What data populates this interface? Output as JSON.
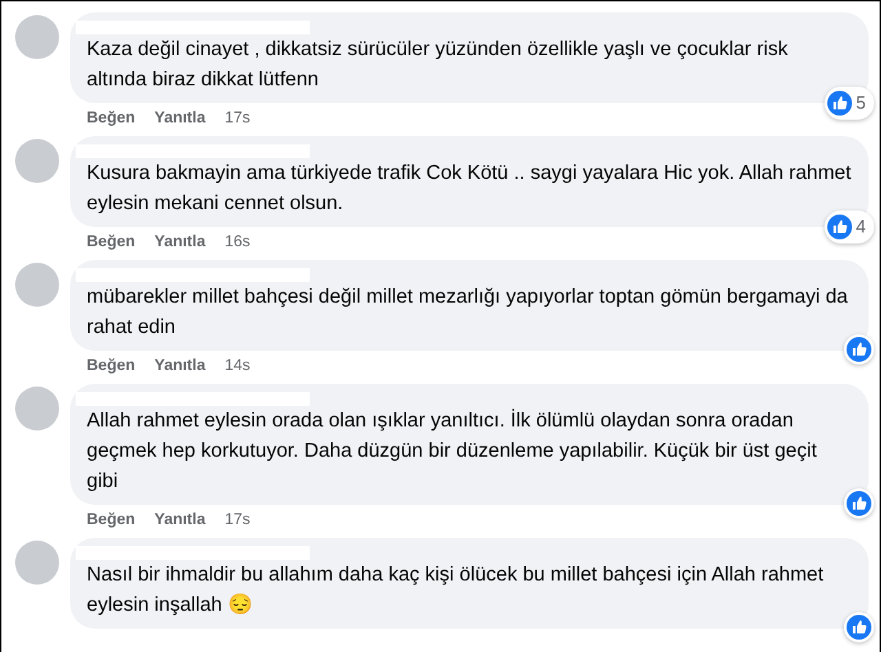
{
  "comments": [
    {
      "text": "Kaza değil cinayet , dikkatsiz sürücüler yüzünden özellikle yaşlı ve çocuklar risk altında biraz dikkat lütfenn",
      "like": "Beğen",
      "reply": "Yanıtla",
      "time": "17s",
      "reactions": "5"
    },
    {
      "text": "Kusura bakmayin ama türkiyede trafik Cok Kötü .. saygi yayalara Hic yok. Allah rahmet eylesin mekani cennet olsun.",
      "like": "Beğen",
      "reply": "Yanıtla",
      "time": "16s",
      "reactions": "4"
    },
    {
      "text": "mübarekler millet bahçesi değil millet mezarlığı yapıyorlar toptan gömün bergamayi da rahat edin",
      "like": "Beğen",
      "reply": "Yanıtla",
      "time": "14s"
    },
    {
      "text": "Allah rahmet eylesin orada olan ışıklar yanıltıcı. İlk ölümlü olaydan sonra oradan geçmek hep korkutuyor. Daha düzgün bir düzenleme yapılabilir. Küçük bir üst geçit gibi",
      "like": "Beğen",
      "reply": "Yanıtla",
      "time": "17s"
    },
    {
      "text": "Nasıl bir ihmaldir bu allahım daha kaç kişi ölücek bu millet bahçesi için Allah rahmet eylesin inşallah 😔"
    }
  ]
}
